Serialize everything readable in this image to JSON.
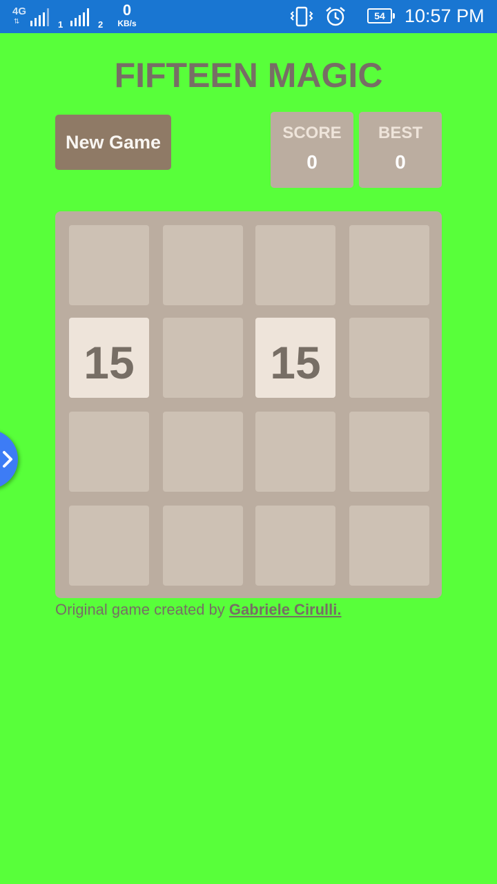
{
  "status_bar": {
    "network_type": "4G",
    "network_arrows": "⇅",
    "sim1": "1",
    "sim2": "2",
    "speed_value": "0",
    "speed_unit": "KB/s",
    "battery": "54",
    "time": "10:57 PM",
    "icons": [
      "vibrate-icon",
      "alarm-icon",
      "battery-icon"
    ]
  },
  "game": {
    "title": "FIFTEEN MAGIC",
    "new_game_label": "New Game",
    "score_label": "SCORE",
    "score_value": "0",
    "best_label": "BEST",
    "best_value": "0",
    "board": [
      [
        "",
        "",
        "",
        ""
      ],
      [
        "15",
        "",
        "15",
        ""
      ],
      [
        "",
        "",
        "",
        ""
      ],
      [
        "",
        "",
        "",
        ""
      ]
    ]
  },
  "footer": {
    "credit_prefix": "Original game created by ",
    "credit_author": "Gabriele Cirulli."
  },
  "colors": {
    "background": "#58ff3a",
    "status_bar": "#1976d2",
    "board": "#bbada0",
    "empty_cell": "#cdc1b4",
    "tile_15": "#eee4da",
    "text": "#776e65",
    "button": "#8f7a66",
    "side_handle": "#3d7cf5"
  }
}
